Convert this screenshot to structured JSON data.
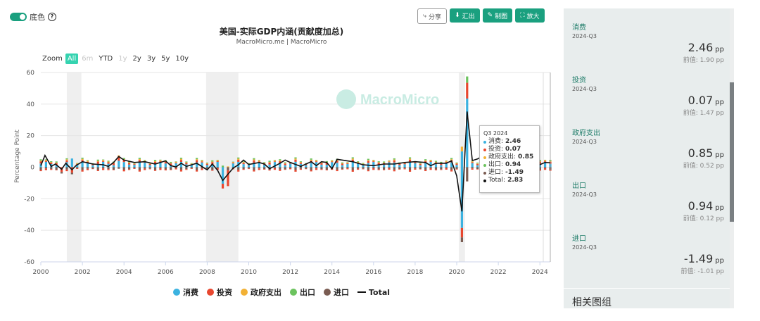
{
  "header": {
    "toggle_label": "底色",
    "help": "?",
    "buttons": {
      "share": "分享",
      "export": "汇出",
      "draw": "制图",
      "expand": "放大"
    }
  },
  "chart_data": {
    "type": "bar",
    "title": "美国-实际GDP内涵(贡献度加总)",
    "subtitle": "MacroMicro.me | MacroMicro",
    "watermark": "MacroMicro",
    "ylabel": "Percentage Point",
    "ylim": [
      -60,
      60
    ],
    "yticks": [
      "60",
      "40",
      "20",
      "0",
      "-20",
      "-40",
      "-60"
    ],
    "xticks": [
      "2000",
      "2002",
      "2004",
      "2006",
      "2008",
      "2010",
      "2012",
      "2014",
      "2016",
      "2018",
      "2020",
      "2022",
      "2024"
    ],
    "xrange": [
      2000.0,
      2024.5
    ],
    "recessions": [
      [
        2001.25,
        2001.95
      ],
      [
        2007.95,
        2009.5
      ],
      [
        2020.1,
        2020.4
      ]
    ],
    "zoom": {
      "label": "Zoom",
      "options": [
        "All",
        "6m",
        "YTD",
        "1y",
        "2y",
        "3y",
        "5y",
        "10y"
      ],
      "active": "All",
      "disabled": [
        "6m",
        "1y"
      ]
    },
    "series": [
      {
        "name": "消费",
        "color": "#3bb2e0"
      },
      {
        "name": "投资",
        "color": "#e8472f"
      },
      {
        "name": "政府支出",
        "color": "#f2b135"
      },
      {
        "name": "出口",
        "color": "#6cc35e"
      },
      {
        "name": "进口",
        "color": "#7a5c52"
      },
      {
        "name": "Total",
        "color": "#111111"
      }
    ],
    "total_points": [
      [
        2000.0,
        1.0
      ],
      [
        2000.2,
        7.5
      ],
      [
        2000.5,
        0.5
      ],
      [
        2000.7,
        2.0
      ],
      [
        2001.0,
        -1.3
      ],
      [
        2001.2,
        2.5
      ],
      [
        2001.5,
        -1.6
      ],
      [
        2001.7,
        1.1
      ],
      [
        2002.0,
        3.5
      ],
      [
        2002.5,
        2.0
      ],
      [
        2003.0,
        1.5
      ],
      [
        2003.25,
        0.5
      ],
      [
        2003.5,
        3.0
      ],
      [
        2003.75,
        6.8
      ],
      [
        2004.0,
        4.5
      ],
      [
        2004.5,
        3.0
      ],
      [
        2005.0,
        3.5
      ],
      [
        2005.5,
        2.0
      ],
      [
        2006.0,
        4.0
      ],
      [
        2006.25,
        1.0
      ],
      [
        2006.5,
        0.2
      ],
      [
        2006.75,
        2.5
      ],
      [
        2007.0,
        0.5
      ],
      [
        2007.5,
        2.5
      ],
      [
        2008.0,
        -1.7
      ],
      [
        2008.25,
        2.0
      ],
      [
        2008.5,
        -2.0
      ],
      [
        2008.75,
        -8.4
      ],
      [
        2009.0,
        -4.4
      ],
      [
        2009.25,
        -0.6
      ],
      [
        2009.5,
        1.5
      ],
      [
        2009.75,
        4.5
      ],
      [
        2010.0,
        1.7
      ],
      [
        2010.5,
        3.0
      ],
      [
        2010.75,
        2.0
      ],
      [
        2011.0,
        -1.0
      ],
      [
        2011.5,
        2.5
      ],
      [
        2011.75,
        4.5
      ],
      [
        2012.0,
        3.0
      ],
      [
        2012.5,
        0.5
      ],
      [
        2013.0,
        3.5
      ],
      [
        2013.25,
        1.0
      ],
      [
        2013.5,
        3.5
      ],
      [
        2013.75,
        3.0
      ],
      [
        2014.0,
        -1.0
      ],
      [
        2014.25,
        5.0
      ],
      [
        2014.5,
        4.5
      ],
      [
        2015.0,
        3.5
      ],
      [
        2015.5,
        1.5
      ],
      [
        2016.0,
        1.0
      ],
      [
        2016.5,
        2.0
      ],
      [
        2017.0,
        2.0
      ],
      [
        2017.5,
        3.0
      ],
      [
        2018.0,
        3.5
      ],
      [
        2018.5,
        3.0
      ],
      [
        2018.75,
        1.0
      ],
      [
        2019.0,
        2.5
      ],
      [
        2019.5,
        2.5
      ],
      [
        2019.75,
        4.0
      ],
      [
        2020.0,
        -5.5
      ],
      [
        2020.25,
        -28.0
      ],
      [
        2020.5,
        35.3
      ],
      [
        2020.75,
        4.2
      ],
      [
        2021.0,
        5.2
      ],
      [
        2021.25,
        7.0
      ],
      [
        2021.5,
        3.3
      ],
      [
        2021.75,
        7.0
      ],
      [
        2022.0,
        -1.6
      ],
      [
        2022.25,
        -0.6
      ],
      [
        2022.5,
        2.7
      ],
      [
        2022.75,
        2.6
      ],
      [
        2023.0,
        2.2
      ],
      [
        2023.25,
        2.1
      ],
      [
        2023.5,
        4.9
      ],
      [
        2023.75,
        3.4
      ],
      [
        2024.0,
        1.6
      ],
      [
        2024.25,
        3.0
      ],
      [
        2024.5,
        2.83
      ]
    ],
    "notable_bars": [
      {
        "x": 2000.2,
        "pos": [
          8.0,
          0,
          0,
          0
        ],
        "neg": [
          -1.5
        ]
      },
      {
        "x": 2001.0,
        "pos": [
          0,
          0,
          0,
          0
        ],
        "neg": [
          -3.0,
          -1.0
        ]
      },
      {
        "x": 2001.5,
        "pos": [
          5.5,
          0,
          0,
          0
        ],
        "neg": [
          -3.5,
          -1.0
        ]
      },
      {
        "x": 2003.75,
        "pos": [
          4.0,
          3.0,
          0.5,
          0
        ],
        "neg": [
          -1.0
        ]
      },
      {
        "x": 2008.75,
        "pos": [
          0,
          0,
          0,
          1.0
        ],
        "neg": [
          -10.5,
          -3.0
        ]
      },
      {
        "x": 2009.0,
        "pos": [
          0,
          0,
          0.5,
          0
        ],
        "neg": [
          -2.0,
          -10.0
        ]
      },
      {
        "x": 2020.25,
        "pos": [
          10.0,
          0,
          3.0,
          0
        ],
        "neg": [
          -38.5,
          -6.0,
          -3.0
        ]
      },
      {
        "x": 2020.5,
        "pos": [
          43.5,
          10.0,
          0,
          4.0
        ],
        "neg": [
          -9.0
        ]
      }
    ],
    "tooltip": {
      "header": "Q3 2024",
      "rows": [
        {
          "name": "消费",
          "value": "2.46",
          "color": "#3bb2e0"
        },
        {
          "name": "投资",
          "value": "0.07",
          "color": "#e8472f"
        },
        {
          "name": "政府支出",
          "value": "0.85",
          "color": "#f2b135"
        },
        {
          "name": "出口",
          "value": "0.94",
          "color": "#6cc35e"
        },
        {
          "name": "进口",
          "value": "-1.49",
          "color": "#7a5c52"
        },
        {
          "name": "Total",
          "value": "2.83",
          "color": "#111111"
        }
      ]
    }
  },
  "sidebar": {
    "items": [
      {
        "name": "消费",
        "date": "2024-Q3",
        "value": "2.46",
        "unit": "pp",
        "prev": "前值: 1.90 pp"
      },
      {
        "name": "投资",
        "date": "2024-Q3",
        "value": "0.07",
        "unit": "pp",
        "prev": "前值: 1.47 pp"
      },
      {
        "name": "政府支出",
        "date": "2024-Q3",
        "value": "0.85",
        "unit": "pp",
        "prev": "前值: 0.52 pp"
      },
      {
        "name": "出口",
        "date": "2024-Q3",
        "value": "0.94",
        "unit": "pp",
        "prev": "前值: 0.12 pp"
      },
      {
        "name": "进口",
        "date": "2024-Q3",
        "value": "-1.49",
        "unit": "pp",
        "prev": "前值: -1.01 pp"
      }
    ],
    "related": "相关图组"
  }
}
